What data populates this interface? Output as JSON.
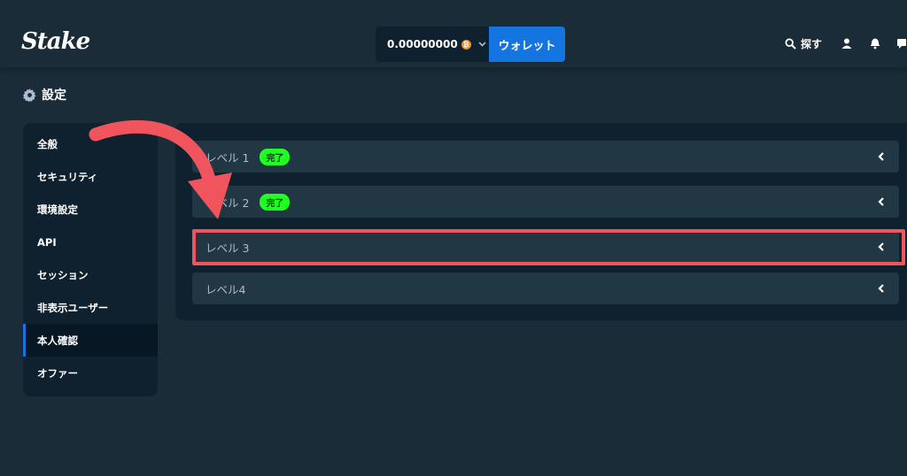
{
  "header": {
    "logo": "Stake",
    "balance": "0.00000000",
    "coin_symbol": "₿",
    "wallet_label": "ウォレット",
    "search_label": "探す",
    "icons": [
      "search-icon",
      "user-icon",
      "bell-icon",
      "chat-icon"
    ]
  },
  "page": {
    "title": "設定",
    "title_icon": "gear-icon"
  },
  "sidebar": {
    "items": [
      {
        "label": "全般"
      },
      {
        "label": "セキュリティ"
      },
      {
        "label": "環境設定"
      },
      {
        "label": "API"
      },
      {
        "label": "セッション"
      },
      {
        "label": "非表示ユーザー"
      },
      {
        "label": "本人確認",
        "active": true
      },
      {
        "label": "オファー"
      }
    ]
  },
  "levels": [
    {
      "label": "レベル 1",
      "badge": "完了"
    },
    {
      "label": "レベル 2",
      "badge": "完了"
    },
    {
      "label": "レベル 3"
    },
    {
      "label": "レベル4"
    }
  ],
  "colors": {
    "background": "#1a2c38",
    "panel": "#0f212e",
    "row": "#213743",
    "accent": "#1475e1",
    "badge": "#1fff20",
    "annotation": "#f0545c"
  }
}
